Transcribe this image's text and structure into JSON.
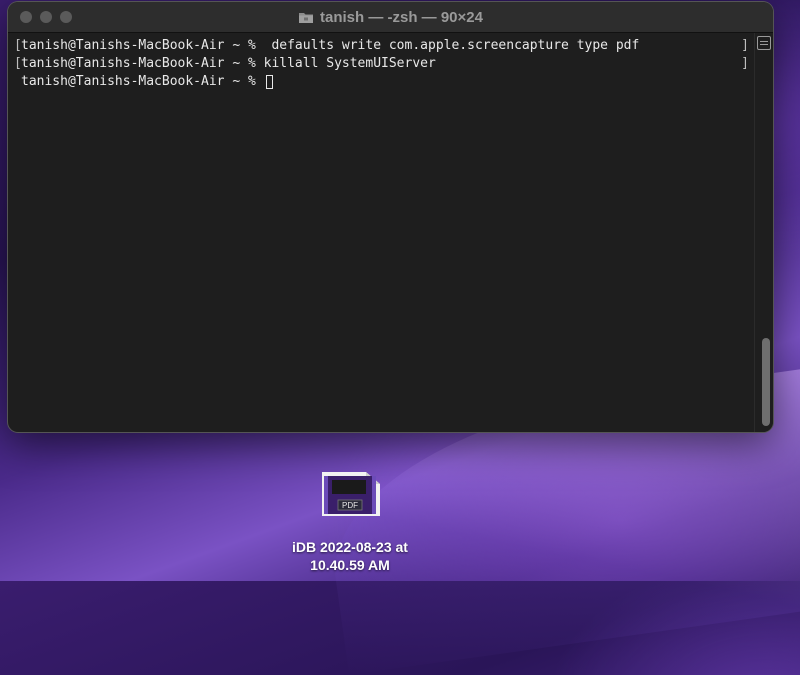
{
  "window": {
    "title": "tanish — -zsh — 90×24",
    "lines": [
      {
        "bracket": "[",
        "text": "tanish@Tanishs-MacBook-Air ~ %  defaults write com.apple.screencapture type pdf",
        "right_bracket": "]"
      },
      {
        "bracket": "[",
        "text": "tanish@Tanishs-MacBook-Air ~ % killall SystemUIServer",
        "right_bracket": "]"
      },
      {
        "bracket": " ",
        "text": "tanish@Tanishs-MacBook-Air ~ % ",
        "right_bracket": ""
      }
    ]
  },
  "desktop": {
    "file_badge": "PDF",
    "file_name_line1": "iDB 2022-08-23 at",
    "file_name_line2": "10.40.59 AM"
  },
  "icons": {
    "folder": "folder-icon",
    "marks": "marks-icon",
    "pdf_thumbnail": "pdf-thumbnail-icon"
  }
}
